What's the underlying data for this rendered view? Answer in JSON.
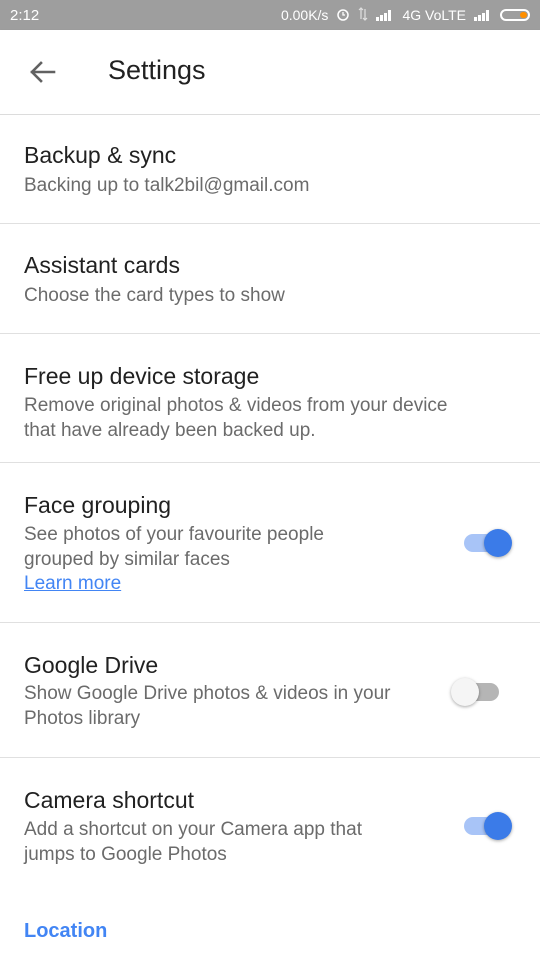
{
  "status_bar": {
    "time": "2:12",
    "net_speed": "0.00K/s",
    "network": "4G VoLTE",
    "battery_accent": "#ff8f00"
  },
  "app_bar": {
    "back_icon": "arrow-back-icon",
    "title": "Settings"
  },
  "settings": [
    {
      "title": "Backup & sync",
      "desc": [
        "Backing up to talk2bil@gmail.com"
      ]
    },
    {
      "title": "Assistant cards",
      "desc": [
        "Choose the card types to show"
      ]
    },
    {
      "title": "Free up device storage",
      "desc": [
        "Remove original photos & videos from your device",
        "that have already been backed up."
      ]
    },
    {
      "title": "Face grouping",
      "desc": [
        "See photos of your favourite people",
        "grouped by similar faces"
      ],
      "link": "Learn more",
      "toggle": true
    },
    {
      "title": "Google Drive",
      "desc": [
        "Show Google Drive photos & videos in your",
        "Photos library"
      ],
      "toggle": false
    },
    {
      "title": "Camera shortcut",
      "desc": [
        "Add a shortcut on your Camera app that",
        "jumps to Google Photos"
      ],
      "toggle": true
    }
  ],
  "section_header": "Location",
  "colors": {
    "accent": "#4285f4",
    "toggle_on": "#3b7be8",
    "status_bar": "#9e9e9e"
  }
}
